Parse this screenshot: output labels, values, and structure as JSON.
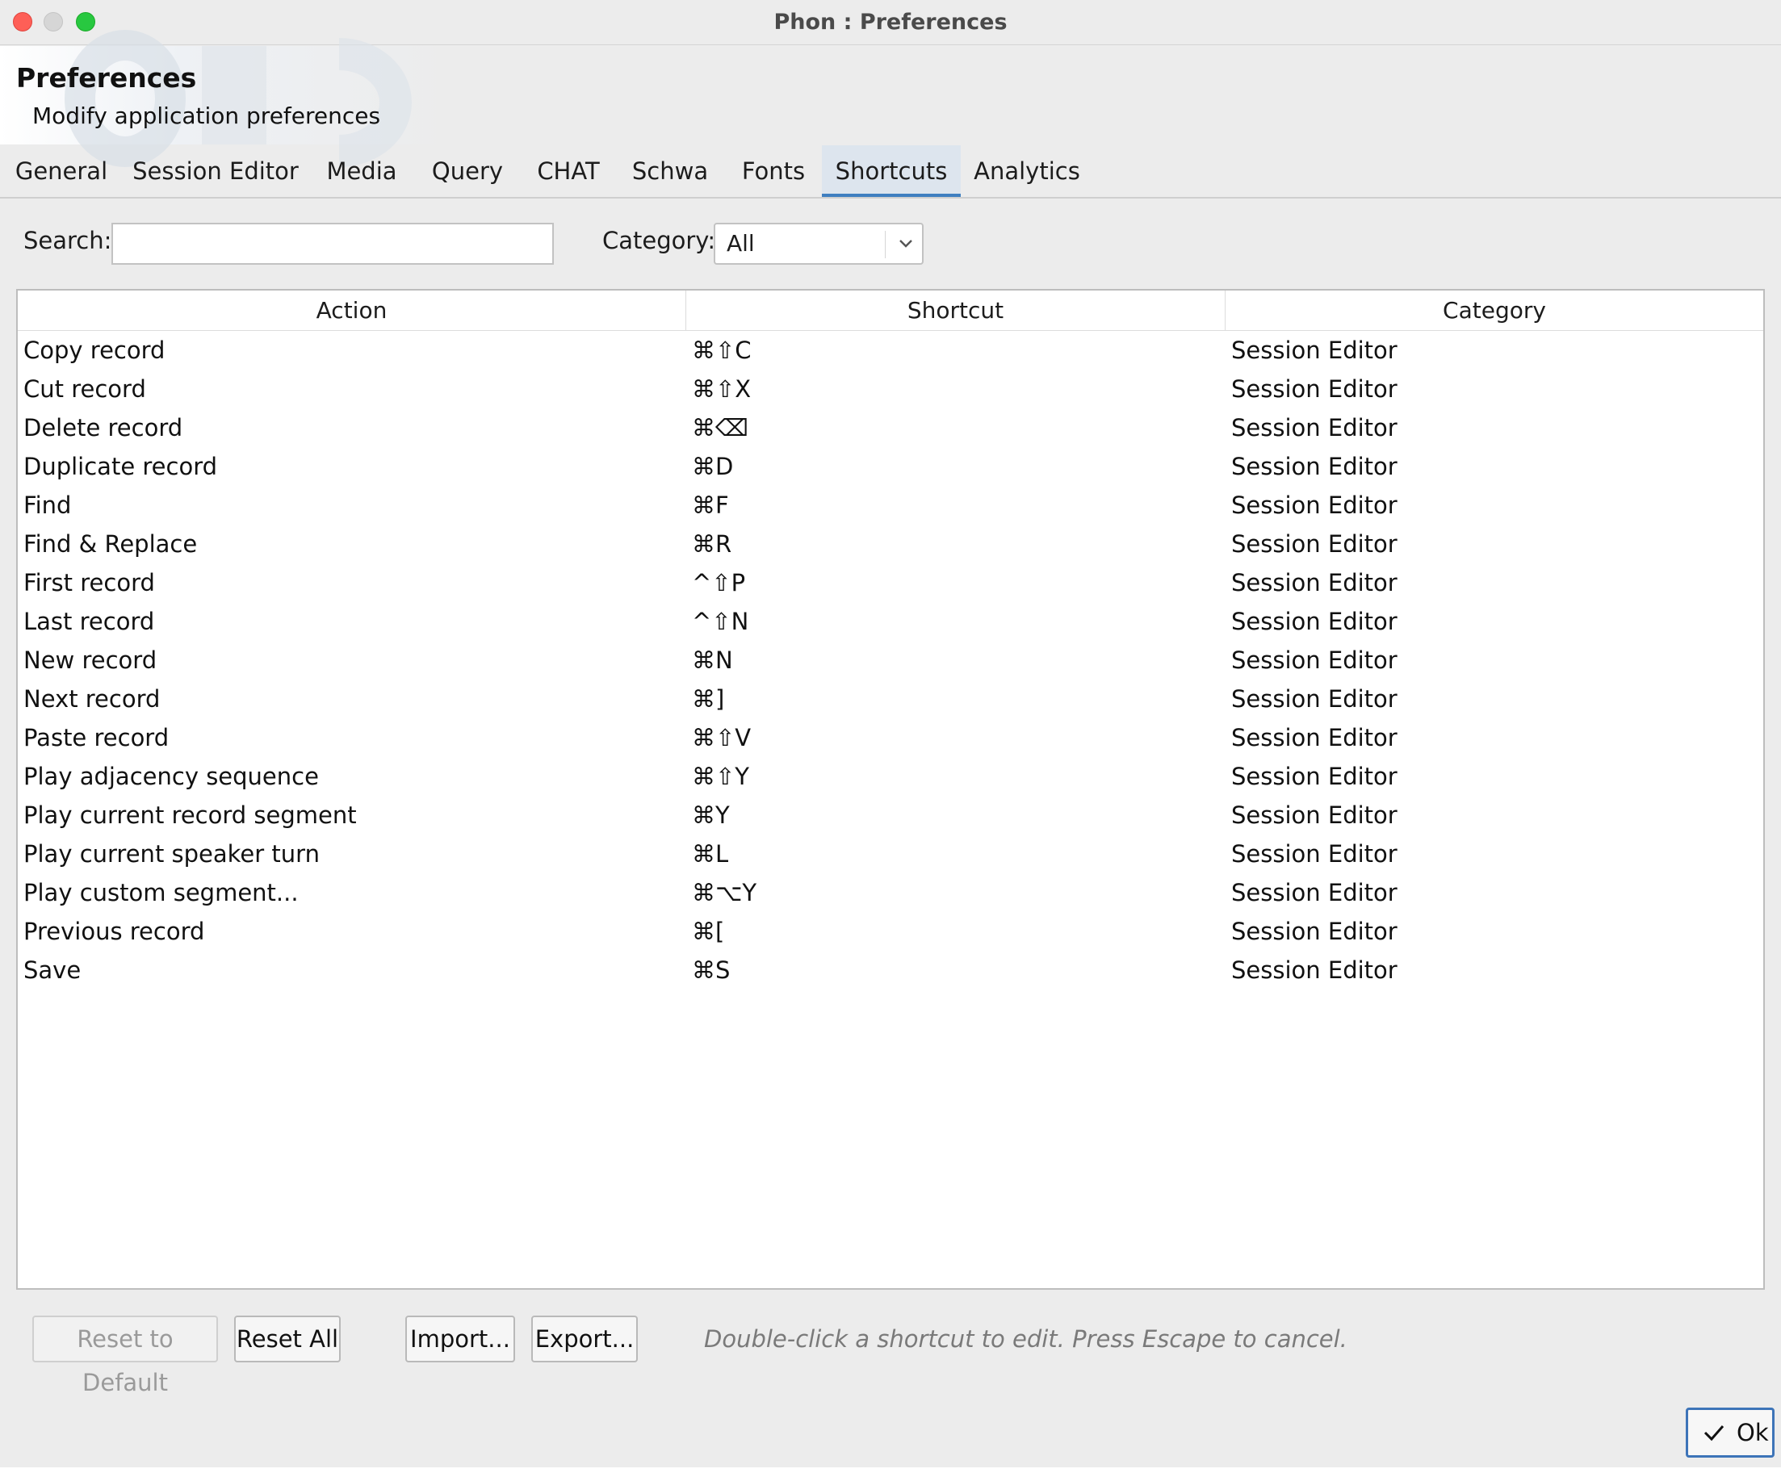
{
  "window": {
    "title": "Phon : Preferences"
  },
  "header": {
    "title": "Preferences",
    "subtitle": "Modify application preferences"
  },
  "tabs": [
    {
      "label": "General"
    },
    {
      "label": "Session Editor"
    },
    {
      "label": "Media"
    },
    {
      "label": "Query"
    },
    {
      "label": "CHAT"
    },
    {
      "label": "Schwa"
    },
    {
      "label": "Fonts"
    },
    {
      "label": "Shortcuts",
      "active": true
    },
    {
      "label": "Analytics"
    }
  ],
  "filters": {
    "search_label": "Search:",
    "search_value": "",
    "category_label": "Category:",
    "category_value": "All"
  },
  "table": {
    "columns": [
      "Action",
      "Shortcut",
      "Category"
    ],
    "rows": [
      [
        "Copy record",
        "⌘⇧C",
        "Session Editor"
      ],
      [
        "Cut record",
        "⌘⇧X",
        "Session Editor"
      ],
      [
        "Delete record",
        "⌘⌫",
        "Session Editor"
      ],
      [
        "Duplicate record",
        "⌘D",
        "Session Editor"
      ],
      [
        "Find",
        "⌘F",
        "Session Editor"
      ],
      [
        "Find & Replace",
        "⌘R",
        "Session Editor"
      ],
      [
        "First record",
        "^⇧P",
        "Session Editor"
      ],
      [
        "Last record",
        "^⇧N",
        "Session Editor"
      ],
      [
        "New record",
        "⌘N",
        "Session Editor"
      ],
      [
        "Next record",
        "⌘]",
        "Session Editor"
      ],
      [
        "Paste record",
        "⌘⇧V",
        "Session Editor"
      ],
      [
        "Play adjacency sequence",
        "⌘⇧Y",
        "Session Editor"
      ],
      [
        "Play current record segment",
        "⌘Y",
        "Session Editor"
      ],
      [
        "Play current speaker turn",
        "⌘L",
        "Session Editor"
      ],
      [
        "Play custom segment...",
        "⌘⌥Y",
        "Session Editor"
      ],
      [
        "Previous record",
        "⌘[",
        "Session Editor"
      ],
      [
        "Save",
        "⌘S",
        "Session Editor"
      ]
    ]
  },
  "buttons": {
    "reset_default": "Reset to Default",
    "reset_all": "Reset All",
    "import": "Import...",
    "export": "Export...",
    "ok": "Ok"
  },
  "hint": "Double-click a shortcut to edit. Press Escape to cancel.",
  "colors": {
    "accent": "#3f7fc0",
    "close": "#fe5f57",
    "maximize": "#28c840"
  }
}
